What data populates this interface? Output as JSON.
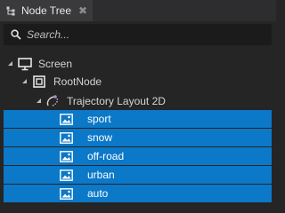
{
  "tab": {
    "title": "Node Tree",
    "close_glyph": "✖",
    "icon": "node-tree-icon"
  },
  "search": {
    "placeholder": "Search...",
    "value": ""
  },
  "tree": {
    "screen": {
      "label": "Screen",
      "icon": "monitor-icon",
      "expanded": true
    },
    "rootnode": {
      "label": "RootNode",
      "icon": "square-node-icon",
      "expanded": true
    },
    "trajectory": {
      "label": "Trajectory Layout 2D",
      "icon": "trajectory-icon",
      "expanded": true
    },
    "items": [
      {
        "label": "sport",
        "icon": "image-icon",
        "selected": true
      },
      {
        "label": "snow",
        "icon": "image-icon",
        "selected": true
      },
      {
        "label": "off-road",
        "icon": "image-icon",
        "selected": true
      },
      {
        "label": "urban",
        "icon": "image-icon",
        "selected": true
      },
      {
        "label": "auto",
        "icon": "image-icon",
        "selected": true
      }
    ]
  },
  "colors": {
    "selection": "#0b78c8",
    "panel_bg": "#252526",
    "search_bg": "#1b1b1c"
  }
}
